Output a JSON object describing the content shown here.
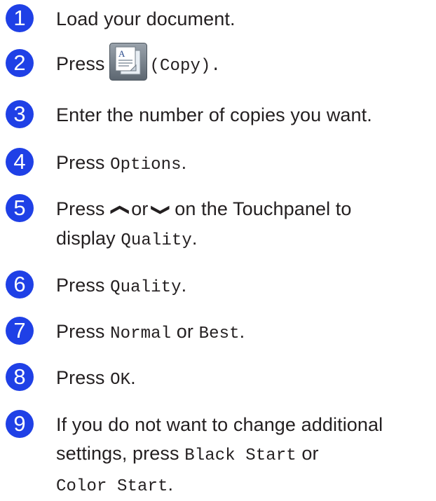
{
  "steps": [
    {
      "num": "1",
      "text": "Load your document."
    },
    {
      "num": "2",
      "press": "Press",
      "copy_label": "(Copy).",
      "icon": "copy-icon"
    },
    {
      "num": "3",
      "text": "Enter the number of copies you want."
    },
    {
      "num": "4",
      "press": "Press",
      "code": "Options",
      "tail": "."
    },
    {
      "num": "5",
      "press": "Press",
      "up_icon": "chevron-up-icon",
      "or": "or",
      "down_icon": "chevron-down-icon",
      "rest": "on the Touchpanel to",
      "line2_pre": "display",
      "code": "Quality",
      "tail": "."
    },
    {
      "num": "6",
      "press": "Press",
      "code": "Quality",
      "tail": "."
    },
    {
      "num": "7",
      "press": "Press",
      "code1": "Normal",
      "or": "or",
      "code2": "Best",
      "tail": "."
    },
    {
      "num": "8",
      "press": "Press",
      "code": "OK",
      "tail": "."
    },
    {
      "num": "9",
      "line1": "If you do not want to change additional",
      "line2_pre": "settings, press",
      "code1": "Black Start",
      "or": "or",
      "code2": "Color Start",
      "tail": "."
    }
  ],
  "colors": {
    "badge": "#1f40e6",
    "text": "#231f20"
  }
}
